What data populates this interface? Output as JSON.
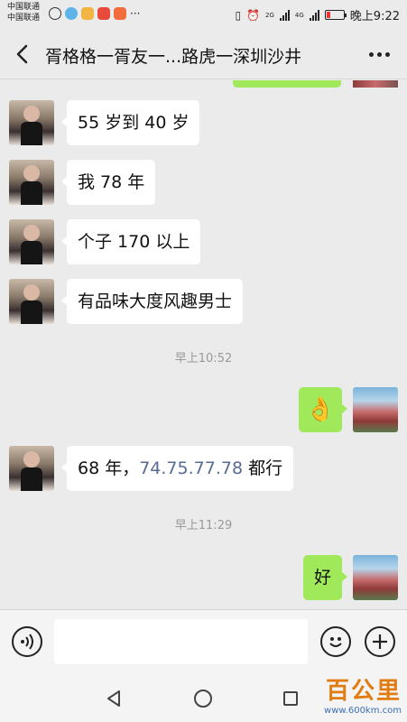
{
  "status_bar": {
    "carrier_1": "中国联通",
    "carrier_2": "中国联通",
    "network_1": "2G",
    "network_2": "4G",
    "time": "晚上9:22",
    "more": "···"
  },
  "header": {
    "title": "胥格格一胥友一...路虎一深圳沙井"
  },
  "messages": [
    {
      "side": "left",
      "text": "55 岁到 40 岁"
    },
    {
      "side": "left",
      "text": "我 78 年"
    },
    {
      "side": "left",
      "text": "个子 170 以上"
    },
    {
      "side": "left",
      "text": "有品味大度风趣男士"
    },
    {
      "side": "time",
      "text": "早上10:52"
    },
    {
      "side": "right",
      "emoji": "👌",
      "icon": "ok-hand-emoji"
    },
    {
      "side": "left",
      "text_prefix": "68 年，",
      "link_text": "74.75.77.78",
      "text_suffix": " 都行"
    },
    {
      "side": "time",
      "text": "早上11:29"
    },
    {
      "side": "right",
      "text": "好"
    }
  ],
  "input_bar": {
    "placeholder": ""
  },
  "watermark": {
    "brand": "百公里",
    "url": "www.600km.com"
  },
  "colors": {
    "background": "#ebebeb",
    "bubble_left": "#ffffff",
    "bubble_right": "#9fe95a",
    "link": "#576b95",
    "time_text": "#999999"
  }
}
